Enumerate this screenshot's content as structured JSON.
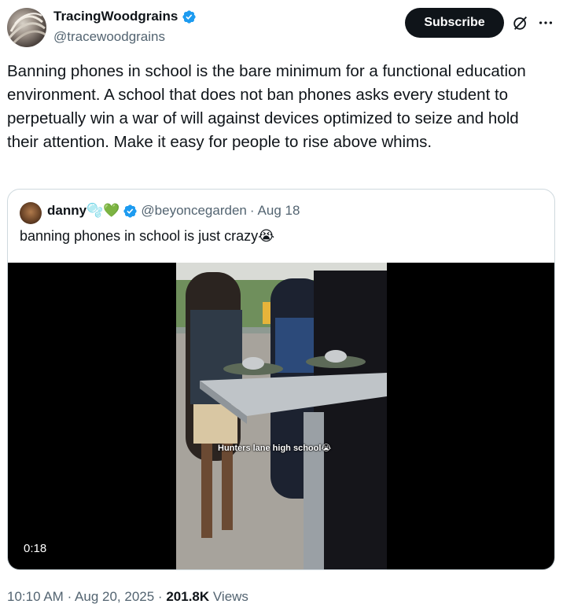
{
  "author": {
    "display_name": "TracingWoodgrains",
    "handle": "@tracewoodgrains",
    "verified": true
  },
  "actions": {
    "subscribe_label": "Subscribe",
    "grok_icon": "grok-icon",
    "more_icon": "more-icon"
  },
  "tweet": {
    "text": "Banning phones in school is the bare minimum for a functional education environment. A school that does not ban phones asks every student to perpetually win a war of will against devices optimized to seize and hold their attention. Make it easy for people to rise above whims."
  },
  "quoted": {
    "display_name": "danny🫧💚",
    "handle": "@beyoncegarden",
    "separator": "·",
    "date": "Aug 18",
    "text": "banning phones in school is just crazy😭",
    "video": {
      "duration": "0:18",
      "caption": "Hunters lane high school😭"
    }
  },
  "meta": {
    "time": "10:10 AM",
    "separator": "·",
    "date": "Aug 20, 2025",
    "separator2": "·",
    "views": "201.8K",
    "views_label": "Views"
  },
  "colors": {
    "text_primary": "#0f1419",
    "text_secondary": "#536471",
    "verified_blue": "#1d9bf0",
    "border": "#cfd9de"
  }
}
